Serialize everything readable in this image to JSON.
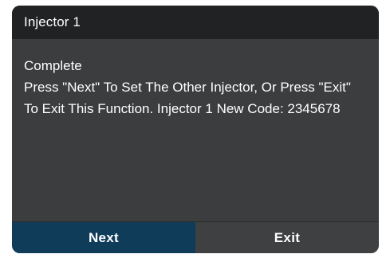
{
  "dialog": {
    "title": "Injector 1",
    "status": "Complete",
    "message": "Press \"Next\" To Set The Other Injector, Or Press \"Exit\" To Exit This Function. Injector 1 New Code: 2345678"
  },
  "buttons": {
    "next_label": "Next",
    "exit_label": "Exit"
  },
  "colors": {
    "title_bar": "#202224",
    "body": "#3b3d3f",
    "next_button": "#0f3c59",
    "exit_button": "#3e4042",
    "text": "#ffffff"
  }
}
